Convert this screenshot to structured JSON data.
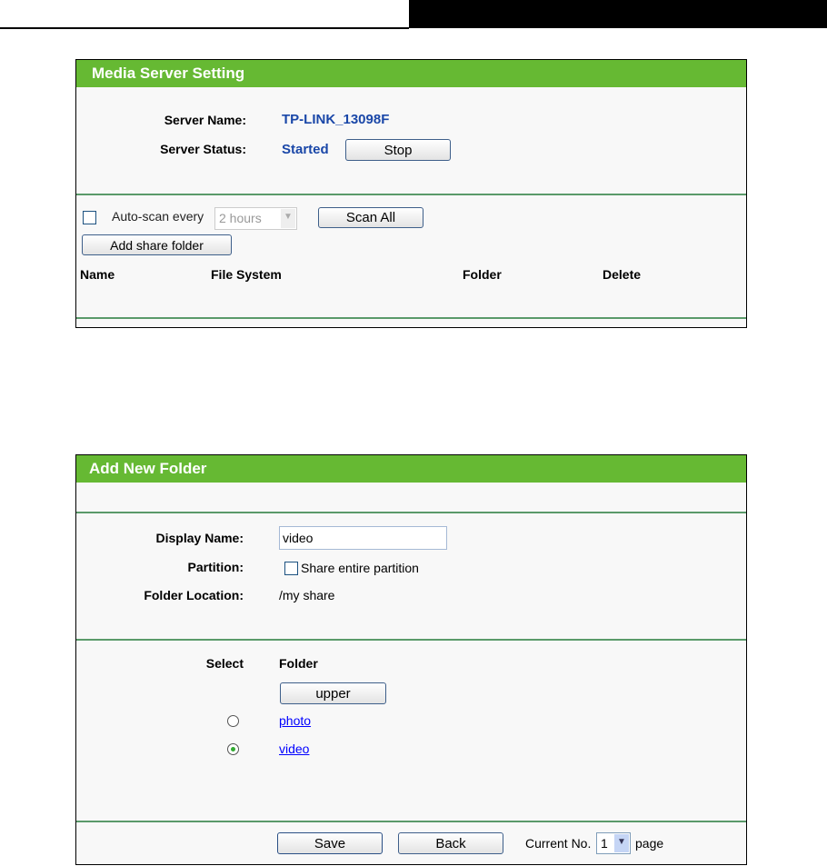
{
  "media_server": {
    "title": "Media Server Setting",
    "server_name_label": "Server Name:",
    "server_name": "TP-LINK_13098F",
    "server_status_label": "Server Status:",
    "server_status": "Started",
    "stop_button": "Stop",
    "auto_scan_label": "Auto-scan every",
    "auto_scan_checked": false,
    "auto_scan_interval": "2 hours",
    "scan_all_button": "Scan All",
    "add_share_folder_button": "Add share folder",
    "columns": [
      "Name",
      "File System",
      "Folder",
      "Delete"
    ]
  },
  "add_folder": {
    "title": "Add New Folder",
    "display_name_label": "Display Name:",
    "display_name_value": "video",
    "partition_label": "Partition:",
    "share_entire_partition": "Share entire partition",
    "folder_location_label": "Folder Location:",
    "folder_location": "/my share",
    "select_header": "Select",
    "folder_header": "Folder",
    "upper_button": "upper",
    "folders": [
      {
        "name": "photo",
        "selected": false
      },
      {
        "name": "video",
        "selected": true
      }
    ],
    "save_button": "Save",
    "back_button": "Back",
    "current_no_label": "Current No.",
    "current_page": "1",
    "page_label": "page"
  }
}
